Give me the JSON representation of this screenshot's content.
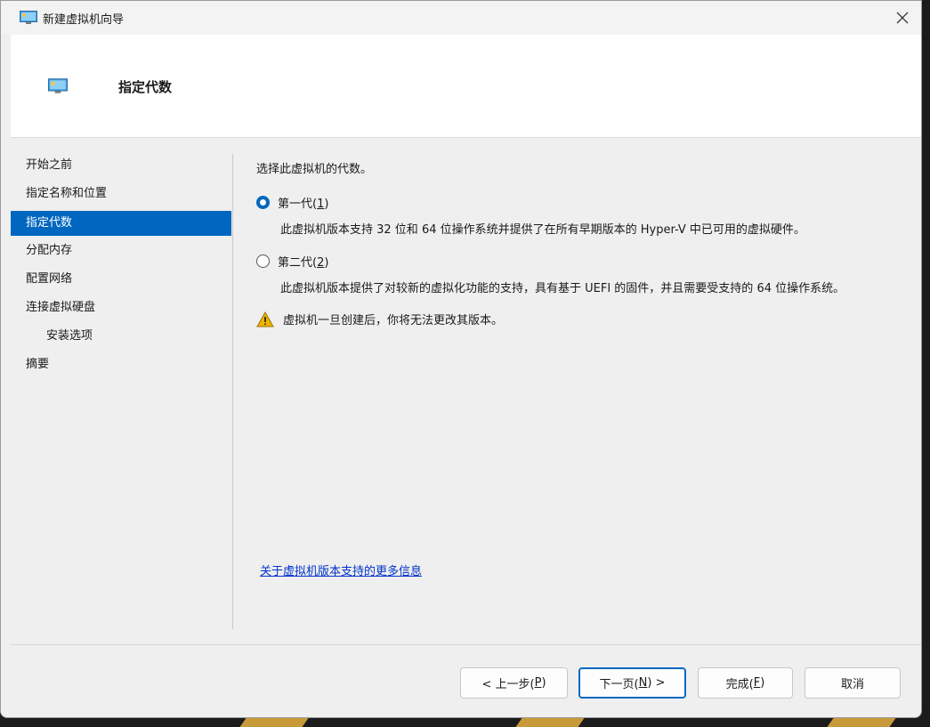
{
  "window": {
    "title": "新建虚拟机向导"
  },
  "header": {
    "title": "指定代数"
  },
  "nav": {
    "items": [
      {
        "label": "开始之前"
      },
      {
        "label": "指定名称和位置"
      },
      {
        "label": "指定代数"
      },
      {
        "label": "分配内存"
      },
      {
        "label": "配置网络"
      },
      {
        "label": "连接虚拟硬盘"
      },
      {
        "label": "安装选项"
      },
      {
        "label": "摘要"
      }
    ],
    "active": "指定代数"
  },
  "content": {
    "prompt": "选择此虚拟机的代数。",
    "gen1": {
      "label_prefix": "第一代(",
      "accel": "1",
      "label_suffix": ")",
      "description": "此虚拟机版本支持 32 位和 64 位操作系统并提供了在所有早期版本的 Hyper-V 中已可用的虚拟硬件。",
      "checked": true
    },
    "gen2": {
      "label_prefix": "第二代(",
      "accel": "2",
      "label_suffix": ")",
      "description": "此虚拟机版本提供了对较新的虚拟化功能的支持，具有基于 UEFI 的固件，并且需要受支持的 64 位操作系统。",
      "checked": false
    },
    "warning": "虚拟机一旦创建后，你将无法更改其版本。",
    "link": "关于虚拟机版本支持的更多信息"
  },
  "buttons": {
    "back": {
      "prefix": "< 上一步(",
      "accel": "P",
      "suffix": ")"
    },
    "next": {
      "prefix": "下一页(",
      "accel": "N",
      "suffix": ") >"
    },
    "finish": {
      "prefix": "完成(",
      "accel": "F",
      "suffix": ")"
    },
    "cancel": {
      "label": "取消"
    }
  },
  "colors": {
    "accent": "#0067c0",
    "link": "#0033cc",
    "warning": "#f0b400"
  },
  "icons": {
    "app": "monitor-icon",
    "close": "close-icon",
    "warning": "warning-icon"
  }
}
